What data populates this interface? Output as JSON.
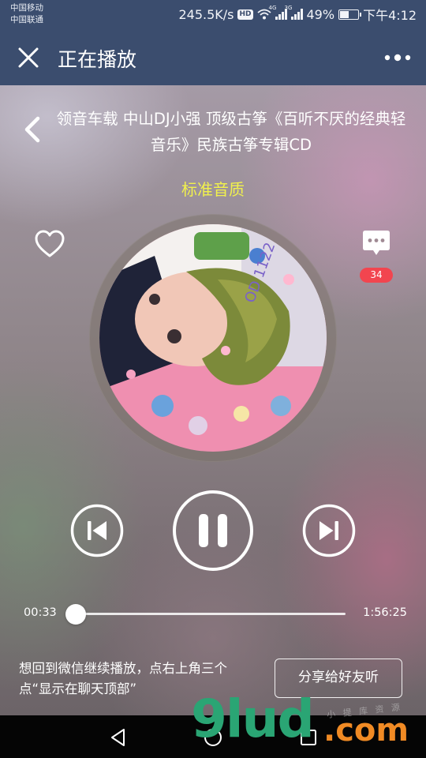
{
  "status_bar": {
    "carrier_1": "中国移动",
    "carrier_2": "中国联通",
    "net_speed": "245.5K/s",
    "hd_badge": "HD",
    "signal_1_tag": "4G",
    "signal_2_tag": "3G",
    "battery": "49%",
    "battery_level": 0.49,
    "time": "下午4:12"
  },
  "header": {
    "title": "正在播放",
    "close_icon": "close-icon",
    "more_icon": "more-dots-icon"
  },
  "player": {
    "song_title": "领音车载 中山DJ小强 顶级古筝《百听不厌的经典轻音乐》民族古筝专辑CD",
    "quality": "标准音质",
    "comment_count": "34",
    "current_time": "00:33",
    "total_time": "1:56:25",
    "progress": 0.0047,
    "state": "playing",
    "hint": "想回到微信继续播放，点右上角三个点“显示在聊天顶部”",
    "share_label": "分享给好友听"
  },
  "colors": {
    "header_bg": "#3b4d6e",
    "quality_text": "#f1f14c",
    "badge_red": "#f2454f",
    "nav_bg": "#050505"
  },
  "watermark": {
    "main": "9lud",
    "domain": ".com",
    "small": "小 提 库 资 源"
  }
}
